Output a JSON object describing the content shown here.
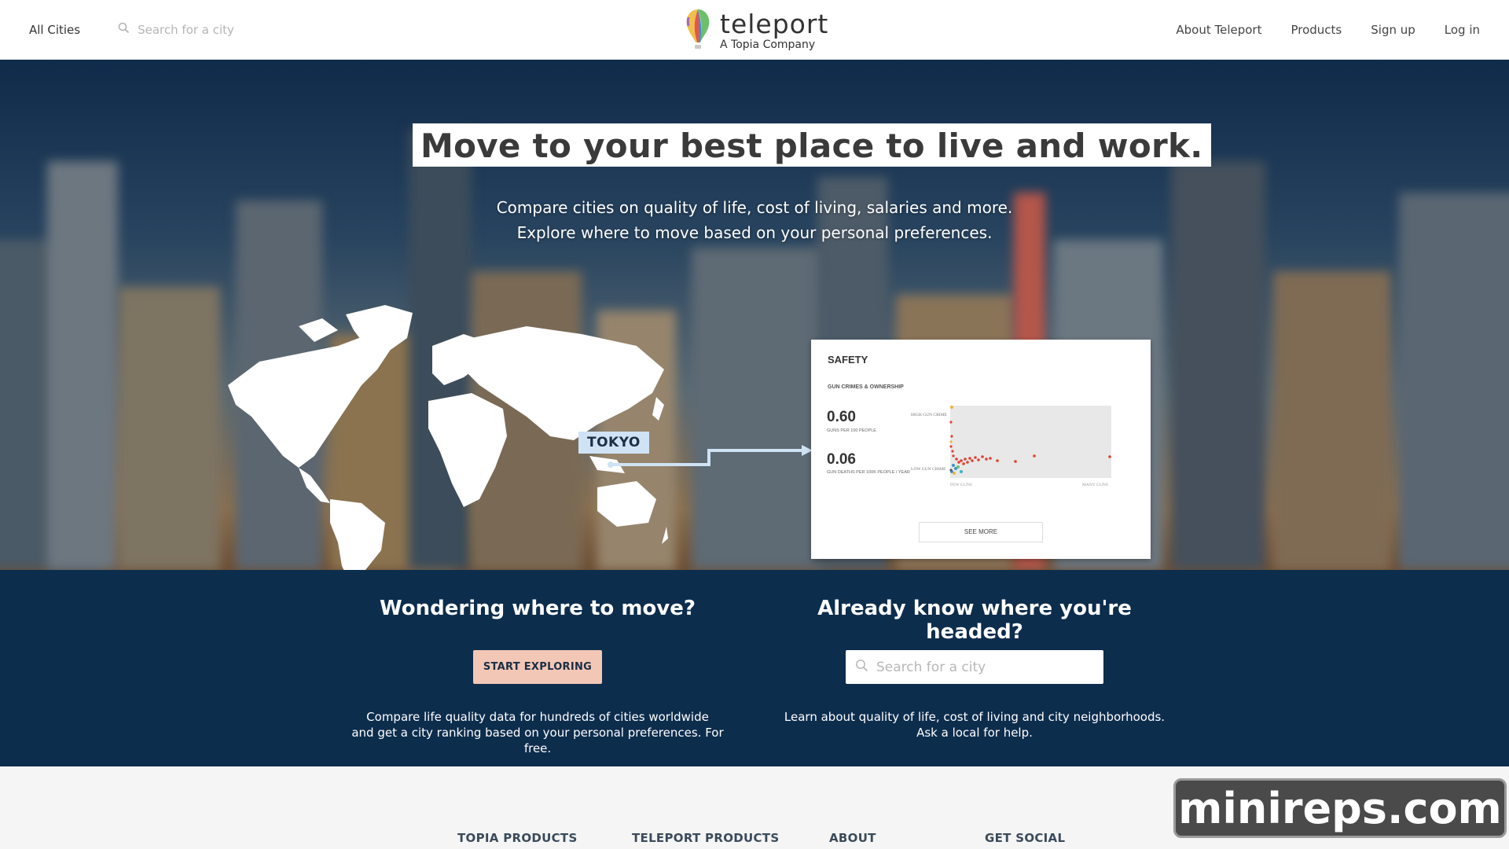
{
  "nav": {
    "all_cities": "All Cities",
    "search_placeholder": "Search for a city",
    "logo_name": "teleport",
    "logo_tagline": "A Topia Company",
    "links": [
      "About Teleport",
      "Products",
      "Sign up",
      "Log in"
    ]
  },
  "hero": {
    "title": "Move to your best place to live and work.",
    "subtitle_line1": "Compare cities on quality of life, cost of living, salaries and more.",
    "subtitle_line2": "Explore where to move based on your personal preferences.",
    "map_city_label": "TOKYO"
  },
  "safety_card": {
    "title": "SAFETY",
    "section": "GUN CRIMES & OWNERSHIP",
    "stat1_value": "0.60",
    "stat1_label": "GUNS PER 100 PEOPLE",
    "stat2_value": "0.06",
    "stat2_label": "GUN DEATHS PER 100K PEOPLE / YEAR",
    "y_high": "HIGH GUN CRIME",
    "y_low": "LOW GUN CRIME",
    "x_low": "FEW GUNS",
    "x_high": "MANY GUNS",
    "button": "SEE MORE"
  },
  "cta_left": {
    "heading": "Wondering where to move?",
    "button": "START EXPLORING",
    "desc_line1": "Compare life quality data for hundreds of cities worldwide",
    "desc_line2": "and get a city ranking based on your personal preferences. For free."
  },
  "cta_right": {
    "heading": "Already know where you're headed?",
    "search_placeholder": "Search for a city",
    "desc_line1": "Learn about quality of life, cost of living and city neighborhoods.",
    "desc_line2": "Ask a local for help."
  },
  "footer": {
    "headings": [
      "TOPIA PRODUCTS",
      "TELEPORT PRODUCTS",
      "ABOUT",
      "GET SOCIAL"
    ]
  },
  "watermark": "minireps.com",
  "colors": {
    "band_bg": "#0d2d4d",
    "explore_button": "#f3c7b6",
    "tokyo_label": "#cfe3f5",
    "scatter_dot": "#e0402f"
  }
}
